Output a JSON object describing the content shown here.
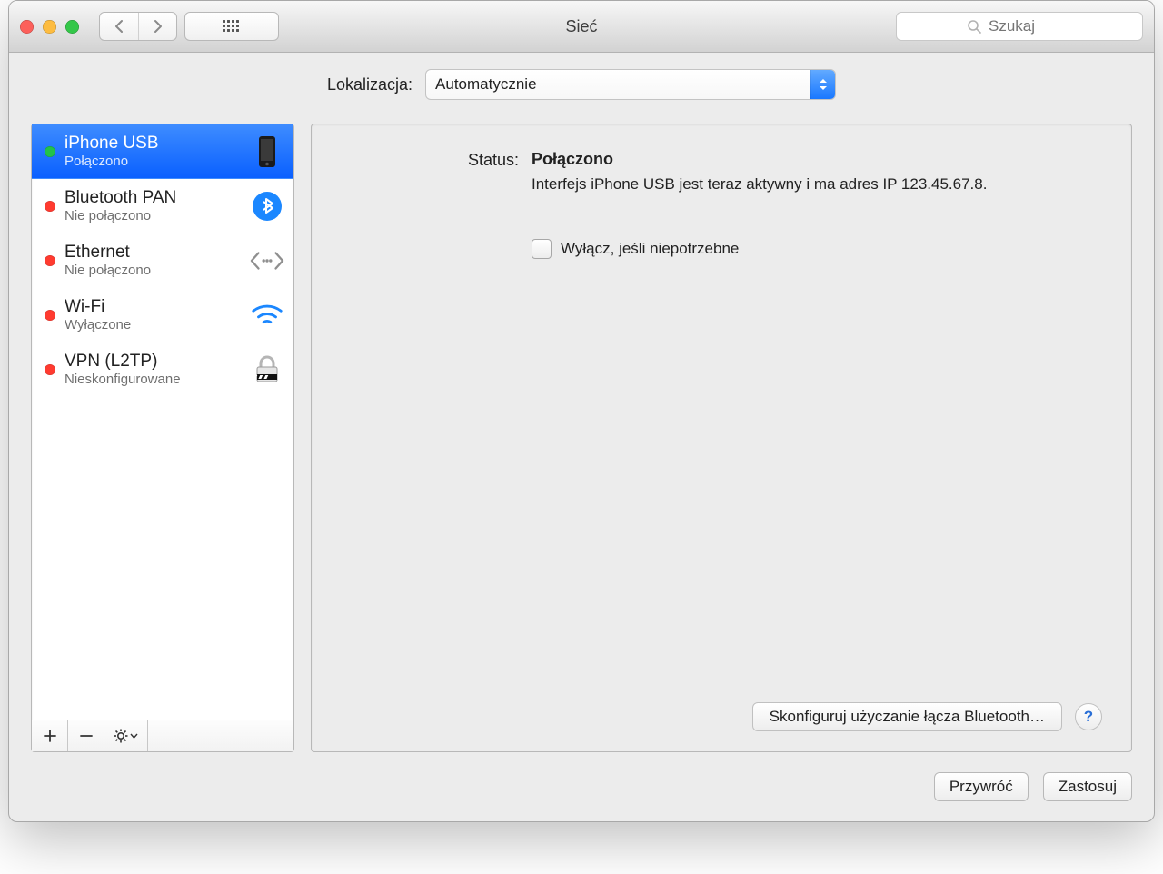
{
  "window": {
    "title": "Sieć"
  },
  "toolbar": {
    "search_placeholder": "Szukaj"
  },
  "location": {
    "label": "Lokalizacja:",
    "value": "Automatycznie"
  },
  "services": [
    {
      "name": "iPhone USB",
      "status": "Połączono",
      "dot": "ok",
      "icon": "iphone",
      "selected": true
    },
    {
      "name": "Bluetooth PAN",
      "status": "Nie połączono",
      "dot": "off",
      "icon": "bluetooth",
      "selected": false
    },
    {
      "name": "Ethernet",
      "status": "Nie połączono",
      "dot": "off",
      "icon": "ethernet",
      "selected": false
    },
    {
      "name": "Wi-Fi",
      "status": "Wyłączone",
      "dot": "off",
      "icon": "wifi",
      "selected": false
    },
    {
      "name": "VPN (L2TP)",
      "status": "Nieskonfigurowane",
      "dot": "off",
      "icon": "vpn",
      "selected": false
    }
  ],
  "detail": {
    "status_label": "Status:",
    "status_value": "Połączono",
    "description": "Interfejs iPhone USB  jest teraz aktywny i ma adres IP 123.45.67.8.",
    "checkbox_label": "Wyłącz, jeśli niepotrzebne",
    "configure_btn": "Skonfiguruj użyczanie łącza Bluetooth…"
  },
  "buttons": {
    "revert": "Przywróć",
    "apply": "Zastosuj",
    "help": "?"
  }
}
